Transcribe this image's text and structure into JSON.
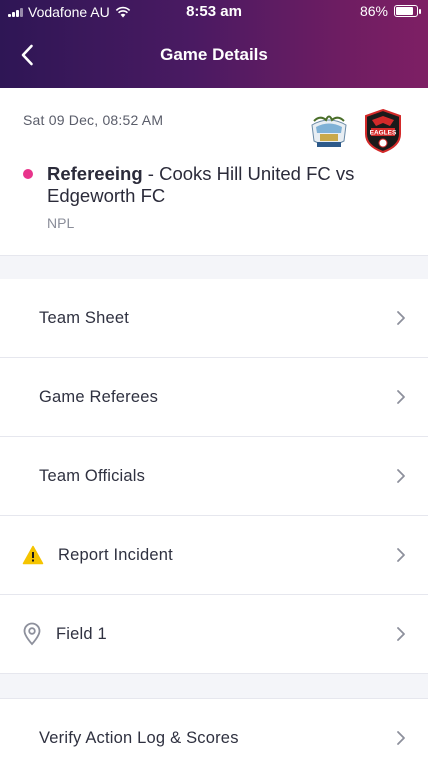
{
  "status_bar": {
    "carrier": "Vodafone AU",
    "time": "8:53 am",
    "battery": "86%",
    "battery_level": 0.86
  },
  "header": {
    "title": "Game Details",
    "back_icon": "chevron-left-icon"
  },
  "game": {
    "date": "Sat 09 Dec, 08:52 AM",
    "role": "Refereeing",
    "separator": " - ",
    "teams": "Cooks Hill United FC vs Edgeworth FC",
    "competition": "NPL",
    "status_color": "#e8348b",
    "home_logo": "cooks-hill-crest-icon",
    "away_logo": "edgeworth-eagles-crest-icon",
    "away_logo_text": "EAGLES"
  },
  "menu": {
    "team_sheet": "Team Sheet",
    "game_referees": "Game Referees",
    "team_officials": "Team Officials",
    "report_incident": "Report Incident",
    "field": "Field 1",
    "verify": "Verify Action Log & Scores"
  },
  "colors": {
    "header_start": "#2e1655",
    "header_end": "#7e1f64",
    "warning": "#f5c400"
  }
}
